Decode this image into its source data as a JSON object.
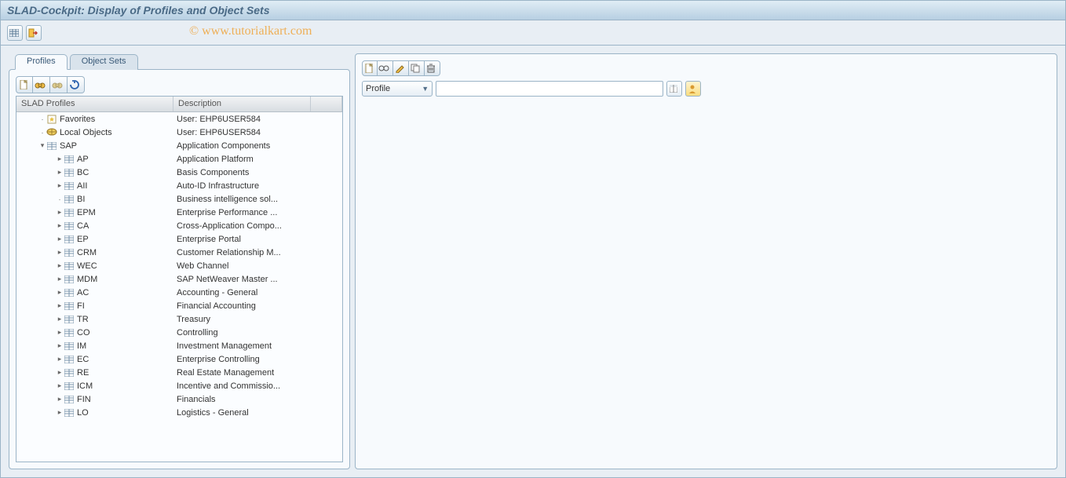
{
  "title": "SLAD-Cockpit: Display of Profiles and Object Sets",
  "watermark": "© www.tutorialkart.com",
  "apptoolbar": {
    "btn1_icon": "table-icon",
    "btn2_icon": "exit-icon"
  },
  "tabs": {
    "profiles": "Profiles",
    "object_sets": "Object Sets",
    "active": "profiles"
  },
  "left_toolbar": {
    "create": "create-icon",
    "find": "find-icon",
    "find_next": "find-next-icon",
    "refresh": "refresh-icon"
  },
  "tree": {
    "header_name": "SLAD Profiles",
    "header_desc": "Description",
    "top": [
      {
        "exp": "·",
        "icon": "favorite",
        "label": "Favorites",
        "desc": "User: EHP6USER584",
        "indent": 0
      },
      {
        "exp": "·",
        "icon": "local",
        "label": "Local Objects",
        "desc": "User: EHP6USER584",
        "indent": 0
      },
      {
        "exp": "▾",
        "icon": "table",
        "label": "SAP",
        "desc": "Application Components",
        "indent": 0
      }
    ],
    "sap_children": [
      {
        "exp": "▸",
        "label": "AP",
        "desc": "Application Platform"
      },
      {
        "exp": "▸",
        "label": "BC",
        "desc": "Basis Components"
      },
      {
        "exp": "▸",
        "label": "AII",
        "desc": "Auto-ID Infrastructure"
      },
      {
        "exp": "·",
        "label": "BI",
        "desc": "Business intelligence sol..."
      },
      {
        "exp": "▸",
        "label": "EPM",
        "desc": "Enterprise Performance ..."
      },
      {
        "exp": "▸",
        "label": "CA",
        "desc": "Cross-Application Compo..."
      },
      {
        "exp": "▸",
        "label": "EP",
        "desc": "Enterprise Portal"
      },
      {
        "exp": "▸",
        "label": "CRM",
        "desc": "Customer Relationship M..."
      },
      {
        "exp": "▸",
        "label": "WEC",
        "desc": "Web Channel"
      },
      {
        "exp": "▸",
        "label": "MDM",
        "desc": "SAP NetWeaver Master ..."
      },
      {
        "exp": "▸",
        "label": "AC",
        "desc": "Accounting - General"
      },
      {
        "exp": "▸",
        "label": "FI",
        "desc": "Financial Accounting"
      },
      {
        "exp": "▸",
        "label": "TR",
        "desc": "Treasury"
      },
      {
        "exp": "▸",
        "label": "CO",
        "desc": "Controlling"
      },
      {
        "exp": "▸",
        "label": "IM",
        "desc": "Investment Management"
      },
      {
        "exp": "▸",
        "label": "EC",
        "desc": "Enterprise Controlling"
      },
      {
        "exp": "▸",
        "label": "RE",
        "desc": "Real Estate Management"
      },
      {
        "exp": "▸",
        "label": "ICM",
        "desc": "Incentive and Commissio..."
      },
      {
        "exp": "▸",
        "label": "FIN",
        "desc": "Financials"
      },
      {
        "exp": "▸",
        "label": "LO",
        "desc": "Logistics - General"
      }
    ]
  },
  "right_toolbar": {
    "b1": "create-icon",
    "b2": "glasses-icon",
    "b3": "pencil-icon",
    "b4": "copy-icon",
    "b5": "delete-icon"
  },
  "form": {
    "select_label": "Profile",
    "input_value": "",
    "valuehelp": "value-help-icon",
    "user": "user-icon"
  }
}
